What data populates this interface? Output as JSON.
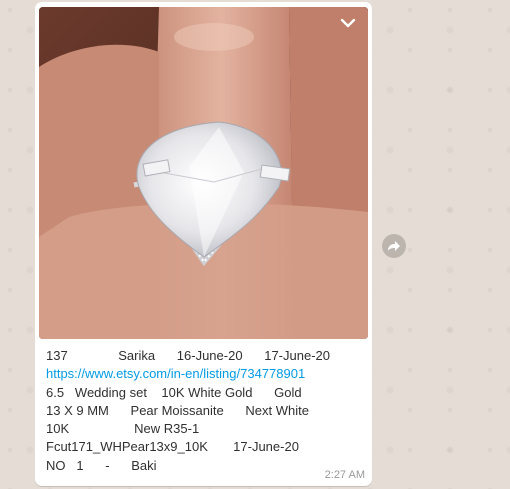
{
  "message": {
    "caption_lines": [
      "137              Sarika      16-June-20      17-June-20",
      "https://www.etsy.com/in-en/listing/734778901",
      "6.5   Wedding set    10K White Gold      Gold",
      "13 X 9 MM      Pear Moissanite      Next White",
      "10K                  New R35-1",
      "Fcut171_WHPear13x9_10K       17-June-20",
      "NO   1      -      Baki"
    ],
    "time": "2:27 AM"
  },
  "icons": {
    "menu": "chevron-down-icon",
    "forward": "forward-icon"
  },
  "colors": {
    "chat_background": "#e5ddd5",
    "bubble": "#ffffff",
    "link": "#039be5",
    "text": "#303030",
    "time": "#999999"
  }
}
